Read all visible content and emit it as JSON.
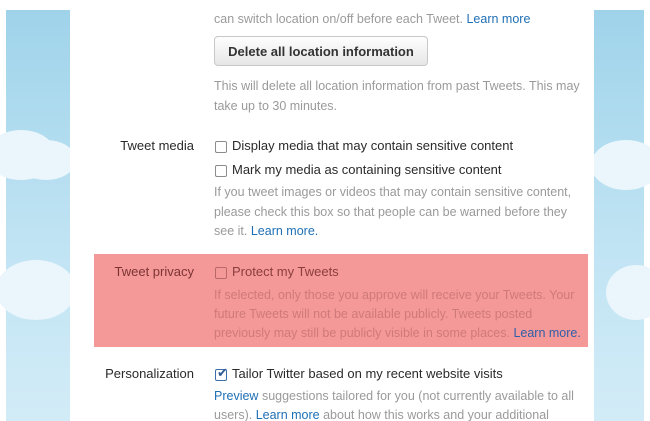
{
  "location": {
    "help_top": "can switch location on/off before each Tweet.",
    "learn_more": "Learn more",
    "delete_button": "Delete all location information",
    "delete_help_line1": "This will delete all location information from past Tweets. This may",
    "delete_help_line2": "take up to 30 minutes."
  },
  "tweet_media": {
    "label": "Tweet media",
    "option1": "Display media that may contain sensitive content",
    "option1_checked": false,
    "option2": "Mark my media as containing sensitive content",
    "option2_checked": false,
    "help_line1": "If you tweet images or videos that may contain sensitive content,",
    "help_line2": "please check this box so that people can be warned before they",
    "help_line3": "see it.",
    "learn_more": "Learn more."
  },
  "tweet_privacy": {
    "label": "Tweet privacy",
    "option": "Protect my Tweets",
    "option_checked": false,
    "help_line1": "If selected, only those you approve will receive your Tweets. Your",
    "help_line2": "future Tweets will not be available publicly. Tweets posted",
    "help_line3": "previously may still be publicly visible in some places.",
    "learn_more": "Learn more.",
    "highlight_color": "#f59898"
  },
  "personalization": {
    "label": "Personalization",
    "option": "Tailor Twitter based on my recent website visits",
    "option_checked": true,
    "preview_link": "Preview",
    "help_line1_rest": "suggestions tailored for you (not currently available to all",
    "help_line2_start": "users).",
    "learn_more": "Learn more",
    "help_line2_rest": "about how this works and your additional"
  },
  "colors": {
    "link": "#1f6fb5",
    "sky": "#9fd3ea"
  }
}
